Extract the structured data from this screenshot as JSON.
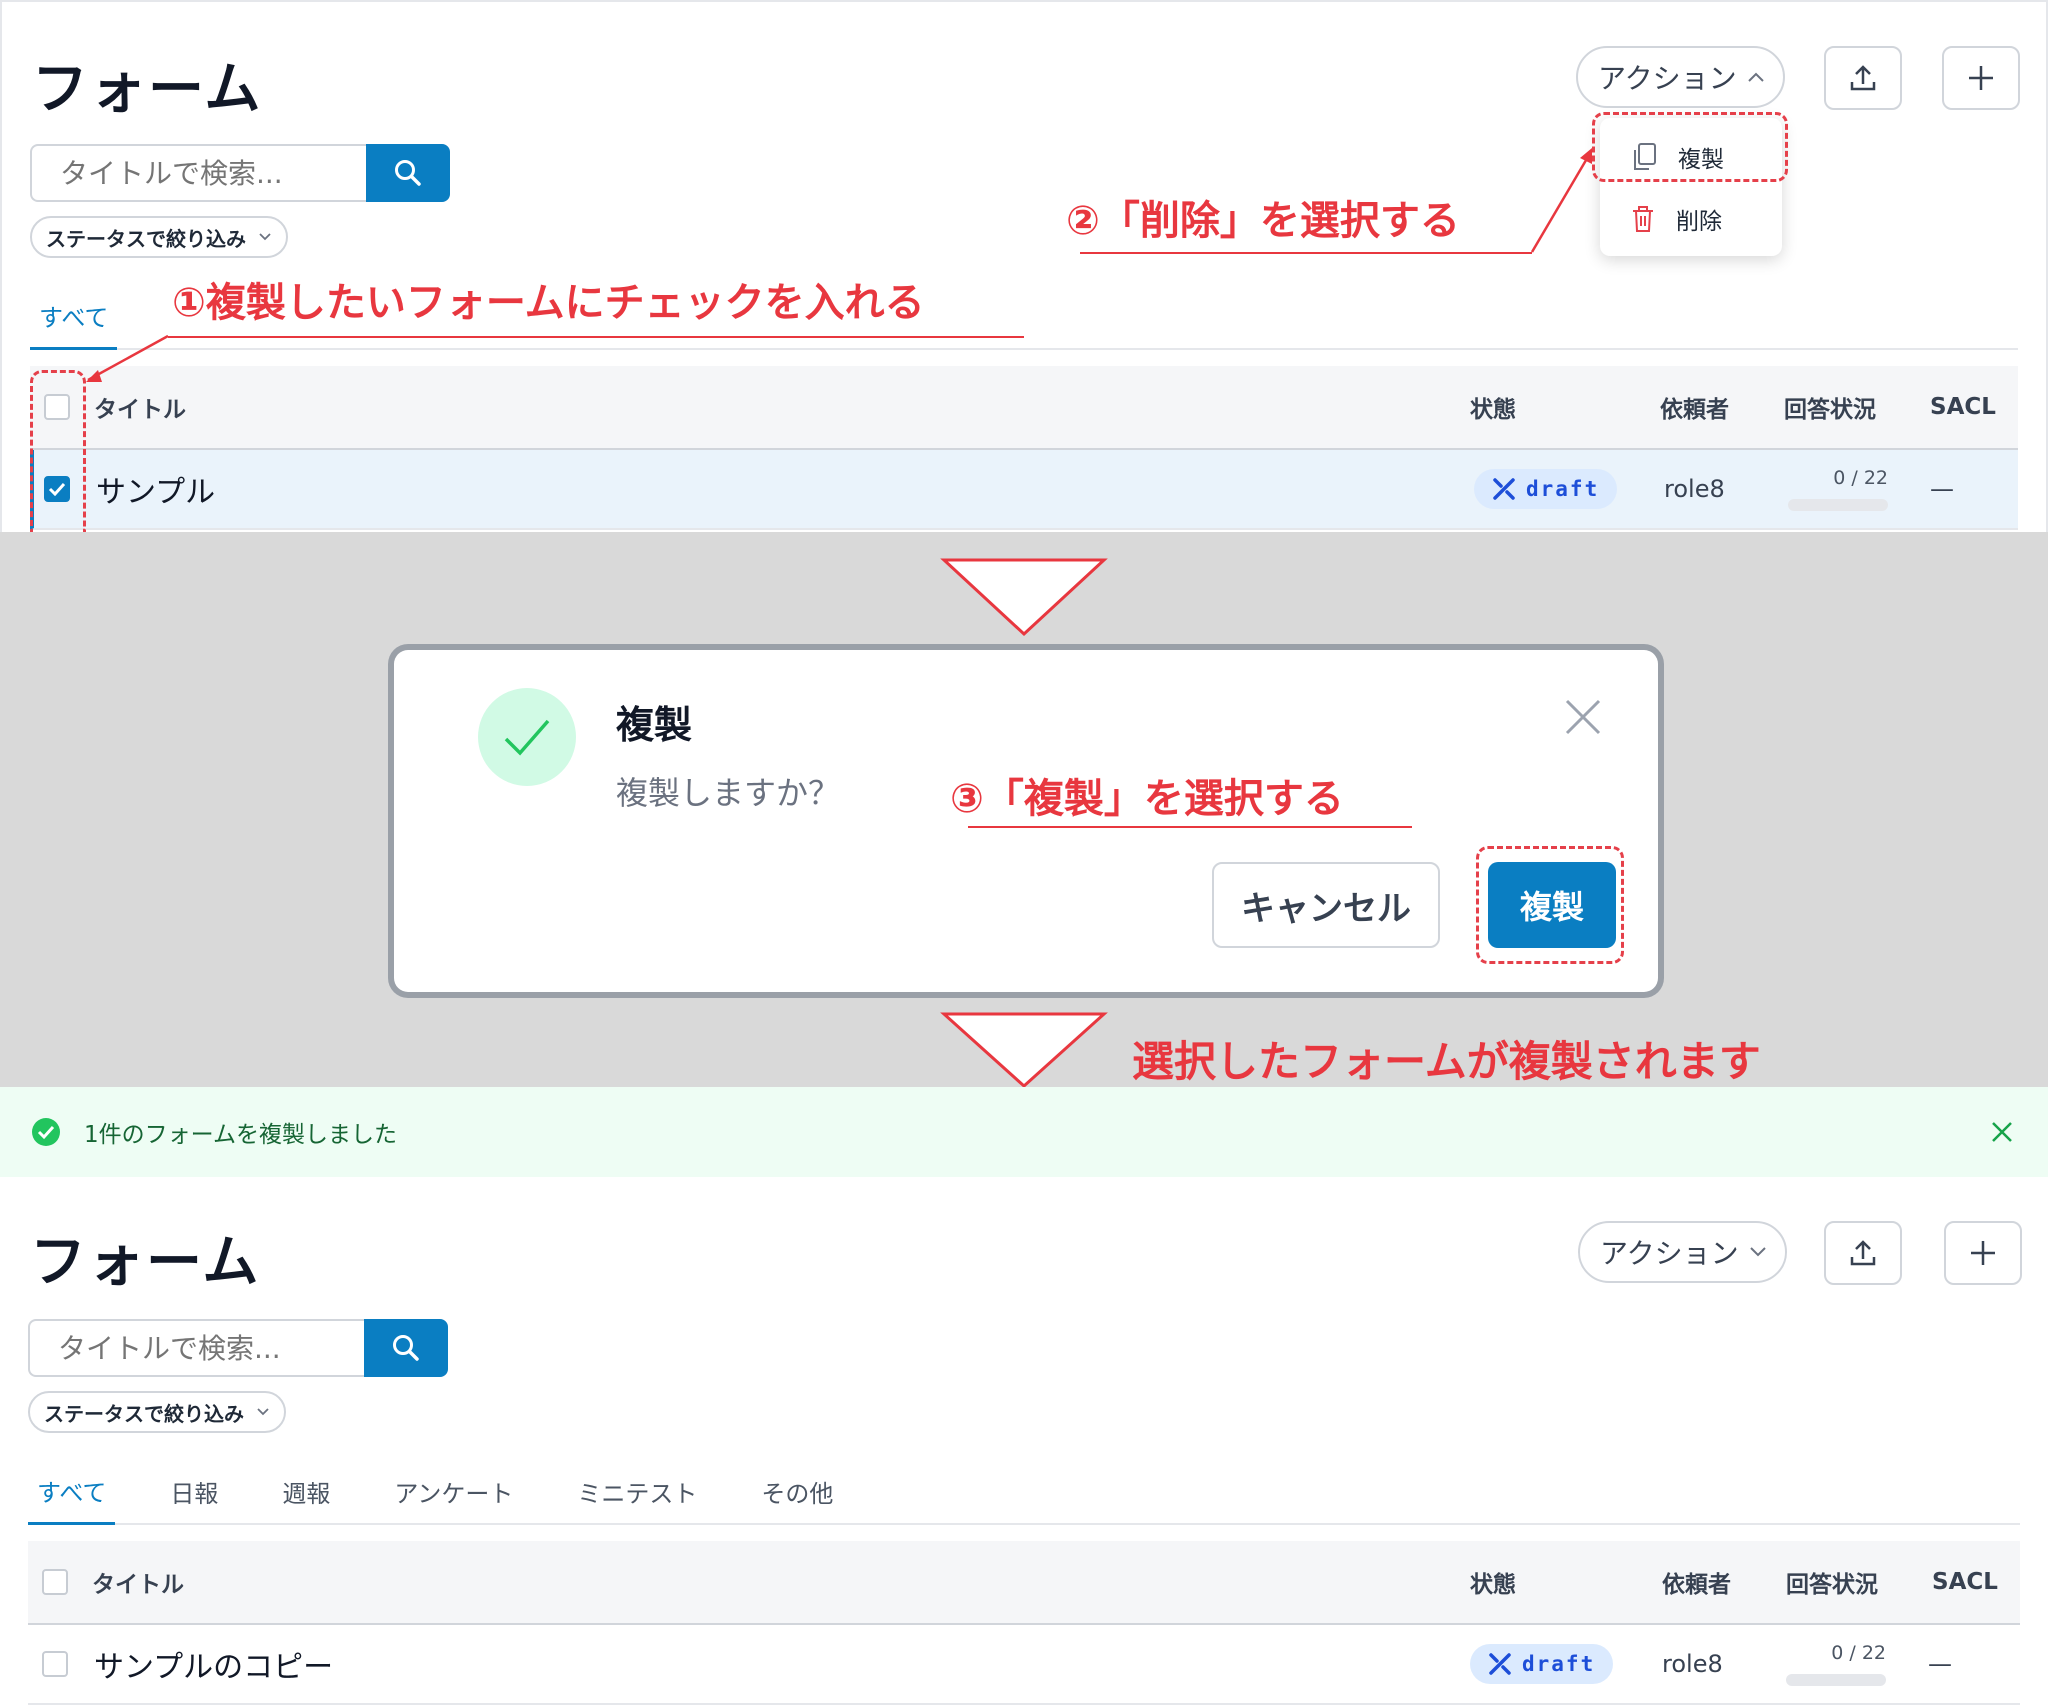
{
  "top": {
    "title": "フォーム",
    "search_placeholder": "タイトルで検索...",
    "filter_label": "ステータスで絞り込み",
    "tabs": [
      {
        "label": "すべて"
      }
    ],
    "action_label": "アクション",
    "dropdown": {
      "duplicate": "複製",
      "delete": "削除"
    },
    "columns": {
      "title": "タイトル",
      "status": "状態",
      "requester": "依頼者",
      "progress": "回答状況",
      "sacl": "SACL"
    },
    "rows": [
      {
        "title": "サンプル",
        "status": "draft",
        "requester": "role8",
        "progress": "0 / 22",
        "progress_value": 0,
        "sacl": "—",
        "checked": true
      }
    ]
  },
  "annotations": {
    "step1": "①複製したいフォームにチェックを入れる",
    "step2": "②「削除」を選択する",
    "step3": "③「複製」を選択する",
    "result": "選択したフォームが複製されます"
  },
  "modal": {
    "title": "複製",
    "message": "複製しますか？",
    "cancel_label": "キャンセル",
    "confirm_label": "複製"
  },
  "toast": {
    "message": "1件のフォームを複製しました"
  },
  "bottom": {
    "title": "フォーム",
    "search_placeholder": "タイトルで検索...",
    "filter_label": "ステータスで絞り込み",
    "tabs": [
      {
        "label": "すべて"
      },
      {
        "label": "日報"
      },
      {
        "label": "週報"
      },
      {
        "label": "アンケート"
      },
      {
        "label": "ミニテスト"
      },
      {
        "label": "その他"
      }
    ],
    "action_label": "アクション",
    "columns": {
      "title": "タイトル",
      "status": "状態",
      "requester": "依頼者",
      "progress": "回答状況",
      "sacl": "SACL"
    },
    "rows": [
      {
        "title": "サンプルのコピー",
        "status": "draft",
        "requester": "role8",
        "progress": "0 / 22",
        "progress_value": 0,
        "sacl": "—",
        "checked": false
      }
    ]
  },
  "colors": {
    "primary": "#0a7ec2",
    "annotation": "#e8373f",
    "success": "#22c55e",
    "badge_bg": "#dbeafe"
  }
}
